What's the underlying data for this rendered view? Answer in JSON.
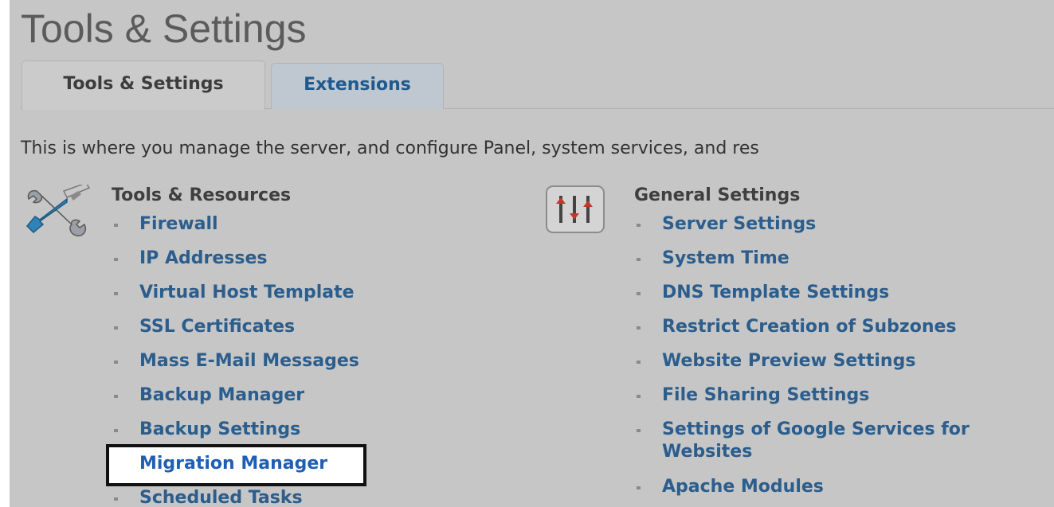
{
  "page": {
    "title": "Tools & Settings"
  },
  "tabs": [
    {
      "label": "Tools & Settings",
      "active": true
    },
    {
      "label": "Extensions",
      "active": false
    }
  ],
  "description": "This is where you manage the server, and configure Panel, system services, and res",
  "groups": {
    "tools": {
      "heading": "Tools & Resources",
      "icon": "wrench-screwdriver-icon",
      "links": [
        "Firewall",
        "IP Addresses",
        "Virtual Host Template",
        "SSL Certificates",
        "Mass E-Mail Messages",
        "Backup Manager",
        "Backup Settings",
        "Migration Manager",
        "Scheduled Tasks"
      ],
      "highlighted": "Migration Manager"
    },
    "general": {
      "heading": "General Settings",
      "icon": "sliders-icon",
      "links": [
        "Server Settings",
        "System Time",
        "DNS Template Settings",
        "Restrict Creation of Subzones",
        "Website Preview Settings",
        "File Sharing Settings",
        "Settings of Google Services for Websites",
        "Apache Modules"
      ]
    }
  },
  "colors": {
    "background": "#c6c6c6",
    "link": "#2b5d8d",
    "highlight_border": "#111111",
    "inactive_tab": "#bfc8d0"
  }
}
